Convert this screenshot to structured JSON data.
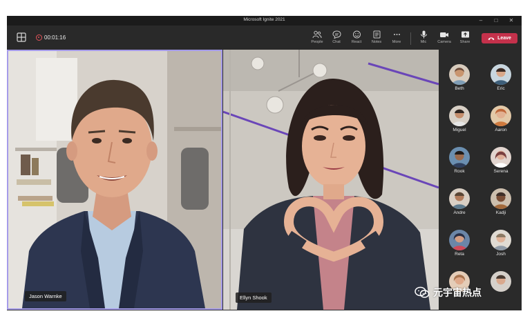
{
  "window": {
    "title": "Microsoft Ignite 2021",
    "controls": [
      "–",
      "□",
      "✕"
    ]
  },
  "toolbar": {
    "timer": "00:01:16",
    "buttons": [
      {
        "label": "People",
        "icon": "people-icon"
      },
      {
        "label": "Chat",
        "icon": "chat-icon"
      },
      {
        "label": "React",
        "icon": "react-icon"
      },
      {
        "label": "Notes",
        "icon": "notes-icon"
      },
      {
        "label": "More",
        "icon": "more-icon"
      },
      {
        "label": "Mic",
        "icon": "mic-icon"
      },
      {
        "label": "Camera",
        "icon": "camera-icon"
      },
      {
        "label": "Share",
        "icon": "share-icon"
      }
    ],
    "leave_label": "Leave",
    "leave_color": "#c4314b"
  },
  "tiles": {
    "left_name": "Jason Warnke",
    "right_name": "Ellyn Shook",
    "active_border_color": "#a59bea"
  },
  "participants": [
    {
      "name": "Beth",
      "color": "#6b4a3a"
    },
    {
      "name": "Eric",
      "color": "#3e5f7a"
    },
    {
      "name": "Miguel",
      "color": "#8a6a52"
    },
    {
      "name": "Aaron",
      "color": "#c0683a"
    },
    {
      "name": "Rook",
      "color": "#2f3e5c"
    },
    {
      "name": "Serena",
      "color": "#7a3f3f"
    },
    {
      "name": "Andre",
      "color": "#5a4636"
    },
    {
      "name": "Kadji",
      "color": "#3f2f28"
    },
    {
      "name": "Reta",
      "color": "#2a2f45"
    },
    {
      "name": "Josh",
      "color": "#8c7a64"
    },
    {
      "name": "",
      "color": "#a8744f"
    },
    {
      "name": "",
      "color": "#4b3d34"
    }
  ],
  "watermark": {
    "text": "元宇宙热点"
  }
}
